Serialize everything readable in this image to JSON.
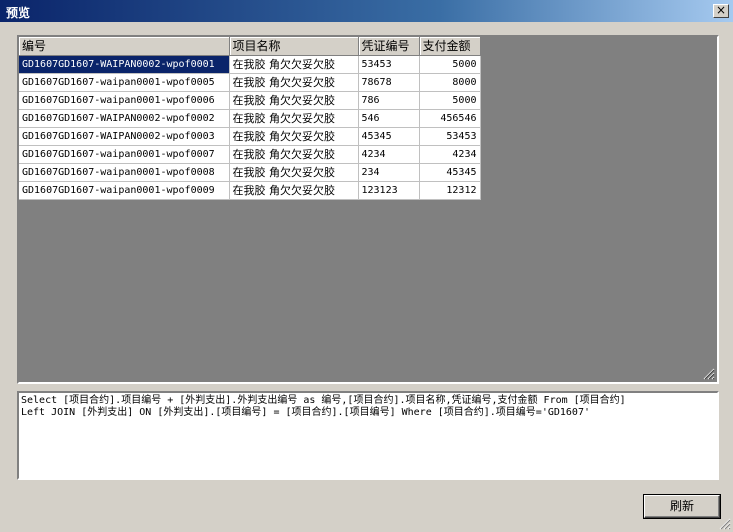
{
  "window": {
    "title": "预览",
    "close_symbol": "×"
  },
  "grid": {
    "columns": [
      "编号",
      "项目名称",
      "凭证编号",
      "支付金额"
    ],
    "rows": [
      [
        "GD1607GD1607-WAIPAN0002-wpof0001",
        "在我胶 角欠欠妥欠胶",
        "53453",
        "5000"
      ],
      [
        "GD1607GD1607-waipan0001-wpof0005",
        "在我胶 角欠欠妥欠胶",
        "78678",
        "8000"
      ],
      [
        "GD1607GD1607-waipan0001-wpof0006",
        "在我胶 角欠欠妥欠胶",
        "786",
        "5000"
      ],
      [
        "GD1607GD1607-WAIPAN0002-wpof0002",
        "在我胶 角欠欠妥欠胶",
        "546",
        "456546"
      ],
      [
        "GD1607GD1607-WAIPAN0002-wpof0003",
        "在我胶 角欠欠妥欠胶",
        "45345",
        "53453"
      ],
      [
        "GD1607GD1607-waipan0001-wpof0007",
        "在我胶 角欠欠妥欠胶",
        "4234",
        "4234"
      ],
      [
        "GD1607GD1607-waipan0001-wpof0008",
        "在我胶 角欠欠妥欠胶",
        "234",
        "45345"
      ],
      [
        "GD1607GD1607-waipan0001-wpof0009",
        "在我胶 角欠欠妥欠胶",
        "123123",
        "12312"
      ]
    ]
  },
  "sql": {
    "line1": "Select [项目合约].项目编号 + [外判支出].外判支出编号 as 编号,[项目合约].项目名称,凭证编号,支付金额 From [项目合约]",
    "line2": "Left JOIN [外判支出] ON [外判支出].[项目编号] = [项目合约].[项目编号] Where [项目合约].项目编号='GD1607'"
  },
  "buttons": {
    "refresh": "刷新"
  },
  "colors": {
    "titlebar_start": "#0a246a",
    "selection": "#0a246a",
    "face": "#d4d0c8",
    "grid_bg": "#808080"
  }
}
